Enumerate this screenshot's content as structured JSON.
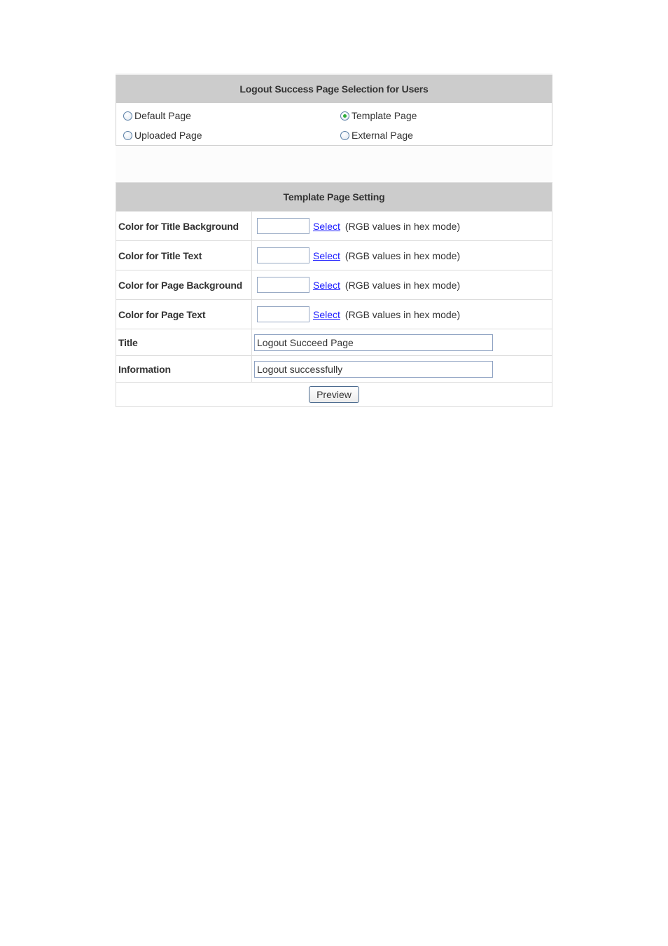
{
  "selection_panel": {
    "title": "Logout Success Page Selection for Users",
    "options": [
      {
        "label": "Default Page",
        "selected": false
      },
      {
        "label": "Template Page",
        "selected": true
      },
      {
        "label": "Uploaded Page",
        "selected": false
      },
      {
        "label": "External Page",
        "selected": false
      }
    ]
  },
  "template_panel": {
    "title": "Template Page Setting",
    "color_rows": [
      {
        "label": "Color for Title Background",
        "value": "",
        "link": "Select",
        "hint": "(RGB values in hex mode)"
      },
      {
        "label": "Color for Title Text",
        "value": "",
        "link": "Select",
        "hint": "(RGB values in hex mode)"
      },
      {
        "label": "Color for Page Background",
        "value": "",
        "link": "Select",
        "hint": "(RGB values in hex mode)"
      },
      {
        "label": "Color for Page Text",
        "value": "",
        "link": "Select",
        "hint": "(RGB values in hex mode)"
      }
    ],
    "title_field": {
      "label": "Title",
      "value": "Logout Succeed Page"
    },
    "information_field": {
      "label": "Information",
      "value": "Logout successfully"
    },
    "preview_button": "Preview"
  },
  "colors": {
    "header_bg": "#cccccc",
    "link": "#1a1aff",
    "radio_selected_dot": "#2fae3a"
  }
}
